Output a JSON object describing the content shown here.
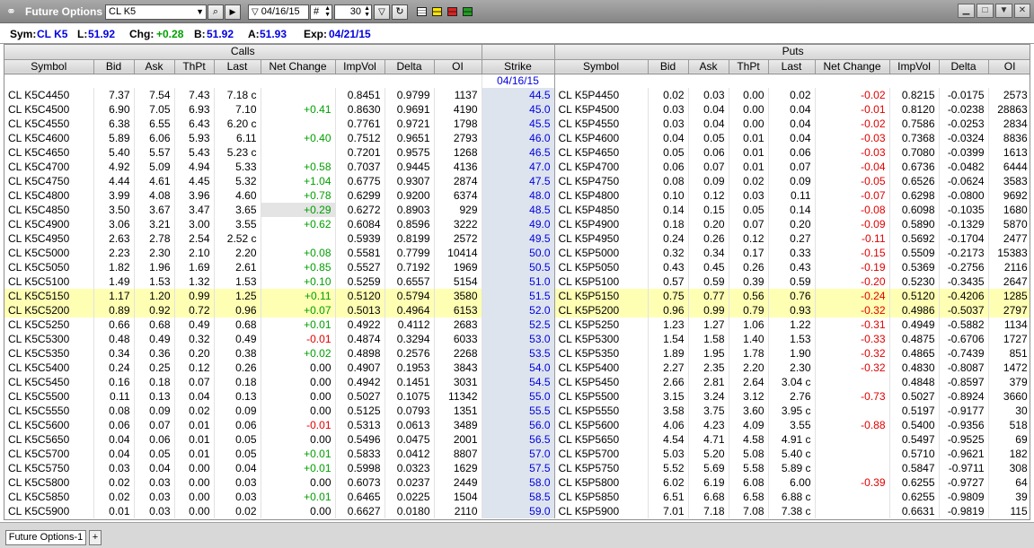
{
  "titlebar": {
    "title": "Future Options",
    "symbol_value": "CL K5",
    "date_value": "04/16/15",
    "hash_value": "#",
    "count_value": "30",
    "link_icon": "chain-link-icon",
    "search_icon": "magnifier-icon",
    "play_icon": "play-icon",
    "filter_icon": "filter-icon",
    "refresh_icon": "refresh-icon"
  },
  "info": {
    "sym_label": "Sym:",
    "sym_value": "CL K5",
    "last_label": "L:",
    "last_value": "51.92",
    "chg_label": "Chg:",
    "chg_value": "+0.28",
    "bid_label": "B:",
    "bid_value": "51.92",
    "ask_label": "A:",
    "ask_value": "51.93",
    "exp_label": "Exp:",
    "exp_value": "04/21/15"
  },
  "bands": {
    "calls": "Calls",
    "puts": "Puts"
  },
  "headers": {
    "calls": [
      "Symbol",
      "Bid",
      "Ask",
      "ThPt",
      "Last",
      "Net Change",
      "ImpVol",
      "Delta",
      "OI"
    ],
    "strike": "Strike",
    "puts": [
      "Symbol",
      "Bid",
      "Ask",
      "ThPt",
      "Last",
      "Net Change",
      "ImpVol",
      "Delta",
      "OI"
    ]
  },
  "strike_date": "04/16/15",
  "rows": [
    {
      "cs": "CL K5C4450",
      "cb": "7.37",
      "ca": "7.54",
      "ct": "7.43",
      "cl": "7.18 c",
      "cn": "",
      "cv": "0.8451",
      "cd": "0.9799",
      "co": "1137",
      "k": "44.5",
      "ps": "CL K5P4450",
      "pb": "0.02",
      "pa": "0.03",
      "pt": "0.00",
      "pl": "0.02",
      "pn": "-0.02",
      "pv": "0.8215",
      "pd": "-0.0175",
      "po": "2573"
    },
    {
      "cs": "CL K5C4500",
      "cb": "6.90",
      "ca": "7.05",
      "ct": "6.93",
      "cl": "7.10",
      "cn": "+0.41",
      "cv": "0.8630",
      "cd": "0.9691",
      "co": "4190",
      "k": "45.0",
      "ps": "CL K5P4500",
      "pb": "0.03",
      "pa": "0.04",
      "pt": "0.00",
      "pl": "0.04",
      "pn": "-0.01",
      "pv": "0.8120",
      "pd": "-0.0238",
      "po": "28863"
    },
    {
      "cs": "CL K5C4550",
      "cb": "6.38",
      "ca": "6.55",
      "ct": "6.43",
      "cl": "6.20 c",
      "cn": "",
      "cv": "0.7761",
      "cd": "0.9721",
      "co": "1798",
      "k": "45.5",
      "ps": "CL K5P4550",
      "pb": "0.03",
      "pa": "0.04",
      "pt": "0.00",
      "pl": "0.04",
      "pn": "-0.02",
      "pv": "0.7586",
      "pd": "-0.0253",
      "po": "2834"
    },
    {
      "cs": "CL K5C4600",
      "cb": "5.89",
      "ca": "6.06",
      "ct": "5.93",
      "cl": "6.11",
      "cn": "+0.40",
      "cv": "0.7512",
      "cd": "0.9651",
      "co": "2793",
      "k": "46.0",
      "ps": "CL K5P4600",
      "pb": "0.04",
      "pa": "0.05",
      "pt": "0.01",
      "pl": "0.04",
      "pn": "-0.03",
      "pv": "0.7368",
      "pd": "-0.0324",
      "po": "8836"
    },
    {
      "cs": "CL K5C4650",
      "cb": "5.40",
      "ca": "5.57",
      "ct": "5.43",
      "cl": "5.23 c",
      "cn": "",
      "cv": "0.7201",
      "cd": "0.9575",
      "co": "1268",
      "k": "46.5",
      "ps": "CL K5P4650",
      "pb": "0.05",
      "pa": "0.06",
      "pt": "0.01",
      "pl": "0.06",
      "pn": "-0.03",
      "pv": "0.7080",
      "pd": "-0.0399",
      "po": "1613"
    },
    {
      "cs": "CL K5C4700",
      "cb": "4.92",
      "ca": "5.09",
      "ct": "4.94",
      "cl": "5.33",
      "cn": "+0.58",
      "cv": "0.7037",
      "cd": "0.9445",
      "co": "4136",
      "k": "47.0",
      "ps": "CL K5P4700",
      "pb": "0.06",
      "pa": "0.07",
      "pt": "0.01",
      "pl": "0.07",
      "pn": "-0.04",
      "pv": "0.6736",
      "pd": "-0.0482",
      "po": "6444"
    },
    {
      "cs": "CL K5C4750",
      "cb": "4.44",
      "ca": "4.61",
      "ct": "4.45",
      "cl": "5.32",
      "cn": "+1.04",
      "cv": "0.6775",
      "cd": "0.9307",
      "co": "2874",
      "k": "47.5",
      "ps": "CL K5P4750",
      "pb": "0.08",
      "pa": "0.09",
      "pt": "0.02",
      "pl": "0.09",
      "pn": "-0.05",
      "pv": "0.6526",
      "pd": "-0.0624",
      "po": "3583"
    },
    {
      "cs": "CL K5C4800",
      "cb": "3.99",
      "ca": "4.08",
      "ct": "3.96",
      "cl": "4.60",
      "cn": "+0.78",
      "cv": "0.6299",
      "cd": "0.9200",
      "co": "6374",
      "k": "48.0",
      "ps": "CL K5P4800",
      "pb": "0.10",
      "pa": "0.12",
      "pt": "0.03",
      "pl": "0.11",
      "pn": "-0.07",
      "pv": "0.6298",
      "pd": "-0.0800",
      "po": "9692"
    },
    {
      "cs": "CL K5C4850",
      "cb": "3.50",
      "ca": "3.67",
      "ct": "3.47",
      "cl": "3.65",
      "cn": "+0.29",
      "cv": "0.6272",
      "cd": "0.8903",
      "co": "929",
      "k": "48.5",
      "ps": "CL K5P4850",
      "pb": "0.14",
      "pa": "0.15",
      "pt": "0.05",
      "pl": "0.14",
      "pn": "-0.08",
      "pv": "0.6098",
      "pd": "-0.1035",
      "po": "1680",
      "sel": true
    },
    {
      "cs": "CL K5C4900",
      "cb": "3.06",
      "ca": "3.21",
      "ct": "3.00",
      "cl": "3.55",
      "cn": "+0.62",
      "cv": "0.6084",
      "cd": "0.8596",
      "co": "3222",
      "k": "49.0",
      "ps": "CL K5P4900",
      "pb": "0.18",
      "pa": "0.20",
      "pt": "0.07",
      "pl": "0.20",
      "pn": "-0.09",
      "pv": "0.5890",
      "pd": "-0.1329",
      "po": "5870"
    },
    {
      "cs": "CL K5C4950",
      "cb": "2.63",
      "ca": "2.78",
      "ct": "2.54",
      "cl": "2.52 c",
      "cn": "",
      "cv": "0.5939",
      "cd": "0.8199",
      "co": "2572",
      "k": "49.5",
      "ps": "CL K5P4950",
      "pb": "0.24",
      "pa": "0.26",
      "pt": "0.12",
      "pl": "0.27",
      "pn": "-0.11",
      "pv": "0.5692",
      "pd": "-0.1704",
      "po": "2477"
    },
    {
      "cs": "CL K5C5000",
      "cb": "2.23",
      "ca": "2.30",
      "ct": "2.10",
      "cl": "2.20",
      "cn": "+0.08",
      "cv": "0.5581",
      "cd": "0.7799",
      "co": "10414",
      "k": "50.0",
      "ps": "CL K5P5000",
      "pb": "0.32",
      "pa": "0.34",
      "pt": "0.17",
      "pl": "0.33",
      "pn": "-0.15",
      "pv": "0.5509",
      "pd": "-0.2173",
      "po": "15383"
    },
    {
      "cs": "CL K5C5050",
      "cb": "1.82",
      "ca": "1.96",
      "ct": "1.69",
      "cl": "2.61",
      "cn": "+0.85",
      "cv": "0.5527",
      "cd": "0.7192",
      "co": "1969",
      "k": "50.5",
      "ps": "CL K5P5050",
      "pb": "0.43",
      "pa": "0.45",
      "pt": "0.26",
      "pl": "0.43",
      "pn": "-0.19",
      "pv": "0.5369",
      "pd": "-0.2756",
      "po": "2116"
    },
    {
      "cs": "CL K5C5100",
      "cb": "1.49",
      "ca": "1.53",
      "ct": "1.32",
      "cl": "1.53",
      "cn": "+0.10",
      "cv": "0.5259",
      "cd": "0.6557",
      "co": "5154",
      "k": "51.0",
      "ps": "CL K5P5100",
      "pb": "0.57",
      "pa": "0.59",
      "pt": "0.39",
      "pl": "0.59",
      "pn": "-0.20",
      "pv": "0.5230",
      "pd": "-0.3435",
      "po": "2647"
    },
    {
      "cs": "CL K5C5150",
      "cb": "1.17",
      "ca": "1.20",
      "ct": "0.99",
      "cl": "1.25",
      "cn": "+0.11",
      "cv": "0.5120",
      "cd": "0.5794",
      "co": "3580",
      "k": "51.5",
      "ps": "CL K5P5150",
      "pb": "0.75",
      "pa": "0.77",
      "pt": "0.56",
      "pl": "0.76",
      "pn": "-0.24",
      "pv": "0.5120",
      "pd": "-0.4206",
      "po": "1285",
      "hl": true
    },
    {
      "cs": "CL K5C5200",
      "cb": "0.89",
      "ca": "0.92",
      "ct": "0.72",
      "cl": "0.96",
      "cn": "+0.07",
      "cv": "0.5013",
      "cd": "0.4964",
      "co": "6153",
      "k": "52.0",
      "ps": "CL K5P5200",
      "pb": "0.96",
      "pa": "0.99",
      "pt": "0.79",
      "pl": "0.93",
      "pn": "-0.32",
      "pv": "0.4986",
      "pd": "-0.5037",
      "po": "2797",
      "hl": true
    },
    {
      "cs": "CL K5C5250",
      "cb": "0.66",
      "ca": "0.68",
      "ct": "0.49",
      "cl": "0.68",
      "cn": "+0.01",
      "cv": "0.4922",
      "cd": "0.4112",
      "co": "2683",
      "k": "52.5",
      "ps": "CL K5P5250",
      "pb": "1.23",
      "pa": "1.27",
      "pt": "1.06",
      "pl": "1.22",
      "pn": "-0.31",
      "pv": "0.4949",
      "pd": "-0.5882",
      "po": "1134"
    },
    {
      "cs": "CL K5C5300",
      "cb": "0.48",
      "ca": "0.49",
      "ct": "0.32",
      "cl": "0.49",
      "cn": "-0.01",
      "cv": "0.4874",
      "cd": "0.3294",
      "co": "6033",
      "k": "53.0",
      "ps": "CL K5P5300",
      "pb": "1.54",
      "pa": "1.58",
      "pt": "1.40",
      "pl": "1.53",
      "pn": "-0.33",
      "pv": "0.4875",
      "pd": "-0.6706",
      "po": "1727"
    },
    {
      "cs": "CL K5C5350",
      "cb": "0.34",
      "ca": "0.36",
      "ct": "0.20",
      "cl": "0.38",
      "cn": "+0.02",
      "cv": "0.4898",
      "cd": "0.2576",
      "co": "2268",
      "k": "53.5",
      "ps": "CL K5P5350",
      "pb": "1.89",
      "pa": "1.95",
      "pt": "1.78",
      "pl": "1.90",
      "pn": "-0.32",
      "pv": "0.4865",
      "pd": "-0.7439",
      "po": "851"
    },
    {
      "cs": "CL K5C5400",
      "cb": "0.24",
      "ca": "0.25",
      "ct": "0.12",
      "cl": "0.26",
      "cn": "0.00",
      "cv": "0.4907",
      "cd": "0.1953",
      "co": "3843",
      "k": "54.0",
      "ps": "CL K5P5400",
      "pb": "2.27",
      "pa": "2.35",
      "pt": "2.20",
      "pl": "2.30",
      "pn": "-0.32",
      "pv": "0.4830",
      "pd": "-0.8087",
      "po": "1472"
    },
    {
      "cs": "CL K5C5450",
      "cb": "0.16",
      "ca": "0.18",
      "ct": "0.07",
      "cl": "0.18",
      "cn": "0.00",
      "cv": "0.4942",
      "cd": "0.1451",
      "co": "3031",
      "k": "54.5",
      "ps": "CL K5P5450",
      "pb": "2.66",
      "pa": "2.81",
      "pt": "2.64",
      "pl": "3.04 c",
      "pn": "",
      "pv": "0.4848",
      "pd": "-0.8597",
      "po": "379"
    },
    {
      "cs": "CL K5C5500",
      "cb": "0.11",
      "ca": "0.13",
      "ct": "0.04",
      "cl": "0.13",
      "cn": "0.00",
      "cv": "0.5027",
      "cd": "0.1075",
      "co": "11342",
      "k": "55.0",
      "ps": "CL K5P5500",
      "pb": "3.15",
      "pa": "3.24",
      "pt": "3.12",
      "pl": "2.76",
      "pn": "-0.73",
      "pv": "0.5027",
      "pd": "-0.8924",
      "po": "3660"
    },
    {
      "cs": "CL K5C5550",
      "cb": "0.08",
      "ca": "0.09",
      "ct": "0.02",
      "cl": "0.09",
      "cn": "0.00",
      "cv": "0.5125",
      "cd": "0.0793",
      "co": "1351",
      "k": "55.5",
      "ps": "CL K5P5550",
      "pb": "3.58",
      "pa": "3.75",
      "pt": "3.60",
      "pl": "3.95 c",
      "pn": "",
      "pv": "0.5197",
      "pd": "-0.9177",
      "po": "30"
    },
    {
      "cs": "CL K5C5600",
      "cb": "0.06",
      "ca": "0.07",
      "ct": "0.01",
      "cl": "0.06",
      "cn": "-0.01",
      "cv": "0.5313",
      "cd": "0.0613",
      "co": "3489",
      "k": "56.0",
      "ps": "CL K5P5600",
      "pb": "4.06",
      "pa": "4.23",
      "pt": "4.09",
      "pl": "3.55",
      "pn": "-0.88",
      "pv": "0.5400",
      "pd": "-0.9356",
      "po": "518"
    },
    {
      "cs": "CL K5C5650",
      "cb": "0.04",
      "ca": "0.06",
      "ct": "0.01",
      "cl": "0.05",
      "cn": "0.00",
      "cv": "0.5496",
      "cd": "0.0475",
      "co": "2001",
      "k": "56.5",
      "ps": "CL K5P5650",
      "pb": "4.54",
      "pa": "4.71",
      "pt": "4.58",
      "pl": "4.91 c",
      "pn": "",
      "pv": "0.5497",
      "pd": "-0.9525",
      "po": "69"
    },
    {
      "cs": "CL K5C5700",
      "cb": "0.04",
      "ca": "0.05",
      "ct": "0.01",
      "cl": "0.05",
      "cn": "+0.01",
      "cv": "0.5833",
      "cd": "0.0412",
      "co": "8807",
      "k": "57.0",
      "ps": "CL K5P5700",
      "pb": "5.03",
      "pa": "5.20",
      "pt": "5.08",
      "pl": "5.40 c",
      "pn": "",
      "pv": "0.5710",
      "pd": "-0.9621",
      "po": "182"
    },
    {
      "cs": "CL K5C5750",
      "cb": "0.03",
      "ca": "0.04",
      "ct": "0.00",
      "cl": "0.04",
      "cn": "+0.01",
      "cv": "0.5998",
      "cd": "0.0323",
      "co": "1629",
      "k": "57.5",
      "ps": "CL K5P5750",
      "pb": "5.52",
      "pa": "5.69",
      "pt": "5.58",
      "pl": "5.89 c",
      "pn": "",
      "pv": "0.5847",
      "pd": "-0.9711",
      "po": "308"
    },
    {
      "cs": "CL K5C5800",
      "cb": "0.02",
      "ca": "0.03",
      "ct": "0.00",
      "cl": "0.03",
      "cn": "0.00",
      "cv": "0.6073",
      "cd": "0.0237",
      "co": "2449",
      "k": "58.0",
      "ps": "CL K5P5800",
      "pb": "6.02",
      "pa": "6.19",
      "pt": "6.08",
      "pl": "6.00",
      "pn": "-0.39",
      "pv": "0.6255",
      "pd": "-0.9727",
      "po": "64"
    },
    {
      "cs": "CL K5C5850",
      "cb": "0.02",
      "ca": "0.03",
      "ct": "0.00",
      "cl": "0.03",
      "cn": "+0.01",
      "cv": "0.6465",
      "cd": "0.0225",
      "co": "1504",
      "k": "58.5",
      "ps": "CL K5P5850",
      "pb": "6.51",
      "pa": "6.68",
      "pt": "6.58",
      "pl": "6.88 c",
      "pn": "",
      "pv": "0.6255",
      "pd": "-0.9809",
      "po": "39"
    },
    {
      "cs": "CL K5C5900",
      "cb": "0.01",
      "ca": "0.03",
      "ct": "0.00",
      "cl": "0.02",
      "cn": "0.00",
      "cv": "0.6627",
      "cd": "0.0180",
      "co": "2110",
      "k": "59.0",
      "ps": "CL K5P5900",
      "pb": "7.01",
      "pa": "7.18",
      "pt": "7.08",
      "pl": "7.38 c",
      "pn": "",
      "pv": "0.6631",
      "pd": "-0.9819",
      "po": "115"
    }
  ],
  "colors": {
    "positive": "#00a000",
    "negative": "#e00000",
    "strike": "#0000e0",
    "highlight": "#ffffb4"
  },
  "bottom": {
    "tab_label": "Future Options-1",
    "add_label": "+"
  }
}
